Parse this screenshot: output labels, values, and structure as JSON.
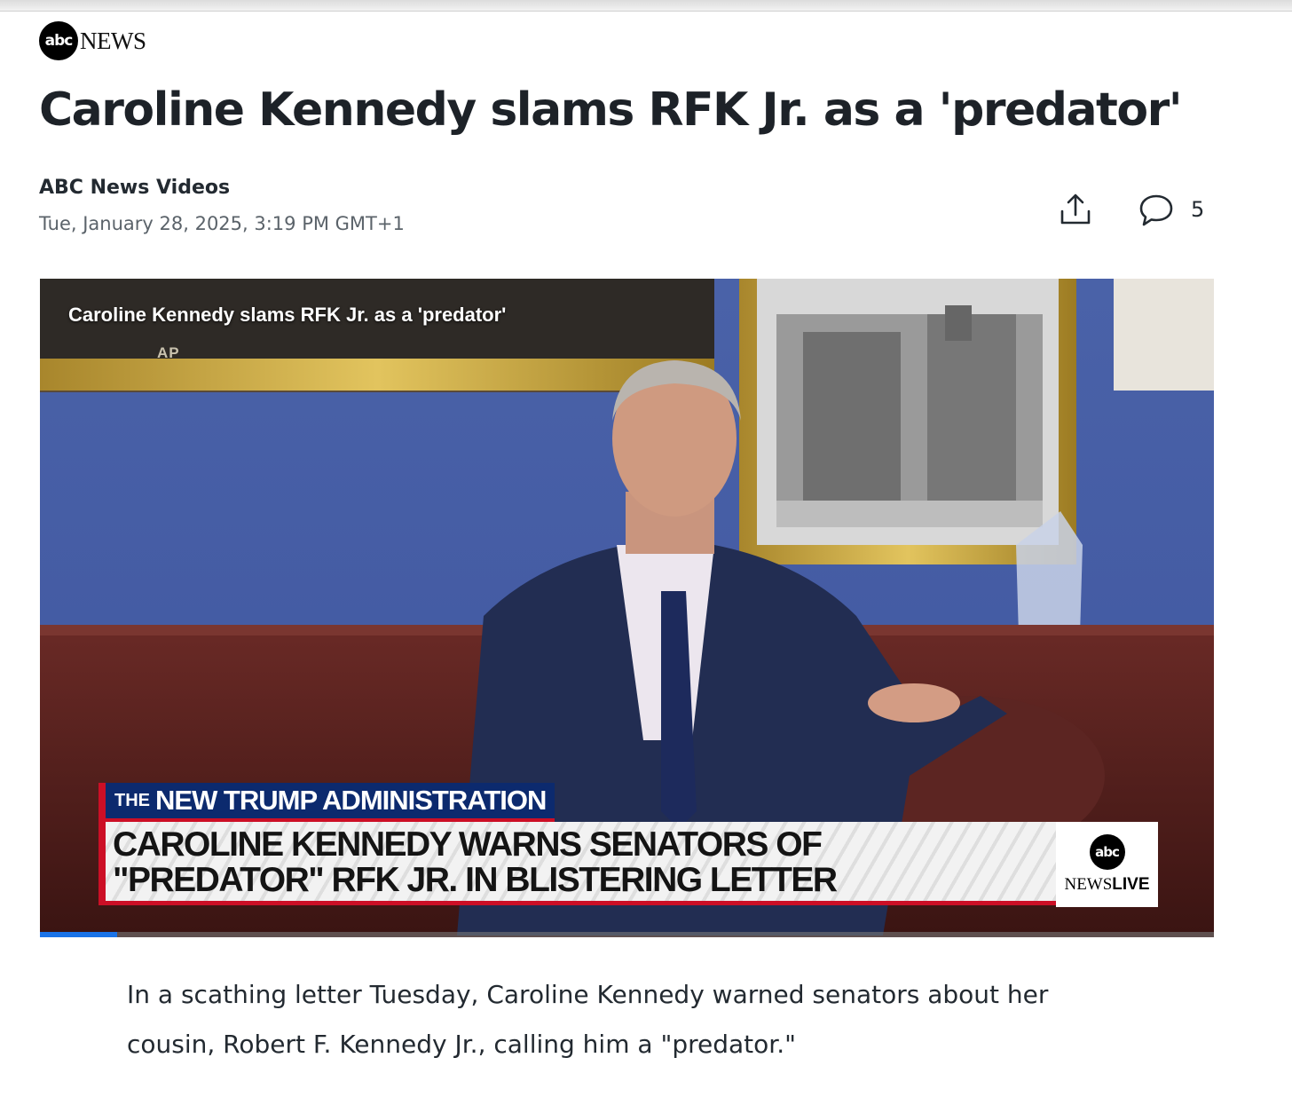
{
  "brand": {
    "logo_mark": "abc",
    "logo_word": "NEWS"
  },
  "article": {
    "headline": "Caroline Kennedy slams RFK Jr. as a 'predator'",
    "source": "ABC News Videos",
    "timestamp": "Tue, January 28, 2025, 3:19 PM GMT+1",
    "summary": "In a scathing letter Tuesday, Caroline Kennedy warned senators about her cousin, Robert F. Kennedy Jr., calling him a \"predator.\""
  },
  "actions": {
    "share_icon": "share-icon",
    "comment_icon": "comment-icon",
    "comment_count": "5"
  },
  "video": {
    "title_overlay": "Caroline Kennedy slams RFK Jr. as a 'predator'",
    "credit": "AP",
    "kicker_small": "THE",
    "kicker_big": "NEW TRUMP ADMINISTRATION",
    "lower_third_line1": "CAROLINE KENNEDY WARNS SENATORS OF",
    "lower_third_line2": "\"PREDATOR\" RFK JR. IN BLISTERING LETTER",
    "live_mark": "abc",
    "live_news": "NEWS",
    "live_live": "LIVE",
    "progress_fraction": 0.066
  },
  "colors": {
    "headline": "#1d2228",
    "kicker_bg": "#0c2a6e",
    "accent_red": "#cc0f26",
    "progress": "#1a73e8"
  }
}
